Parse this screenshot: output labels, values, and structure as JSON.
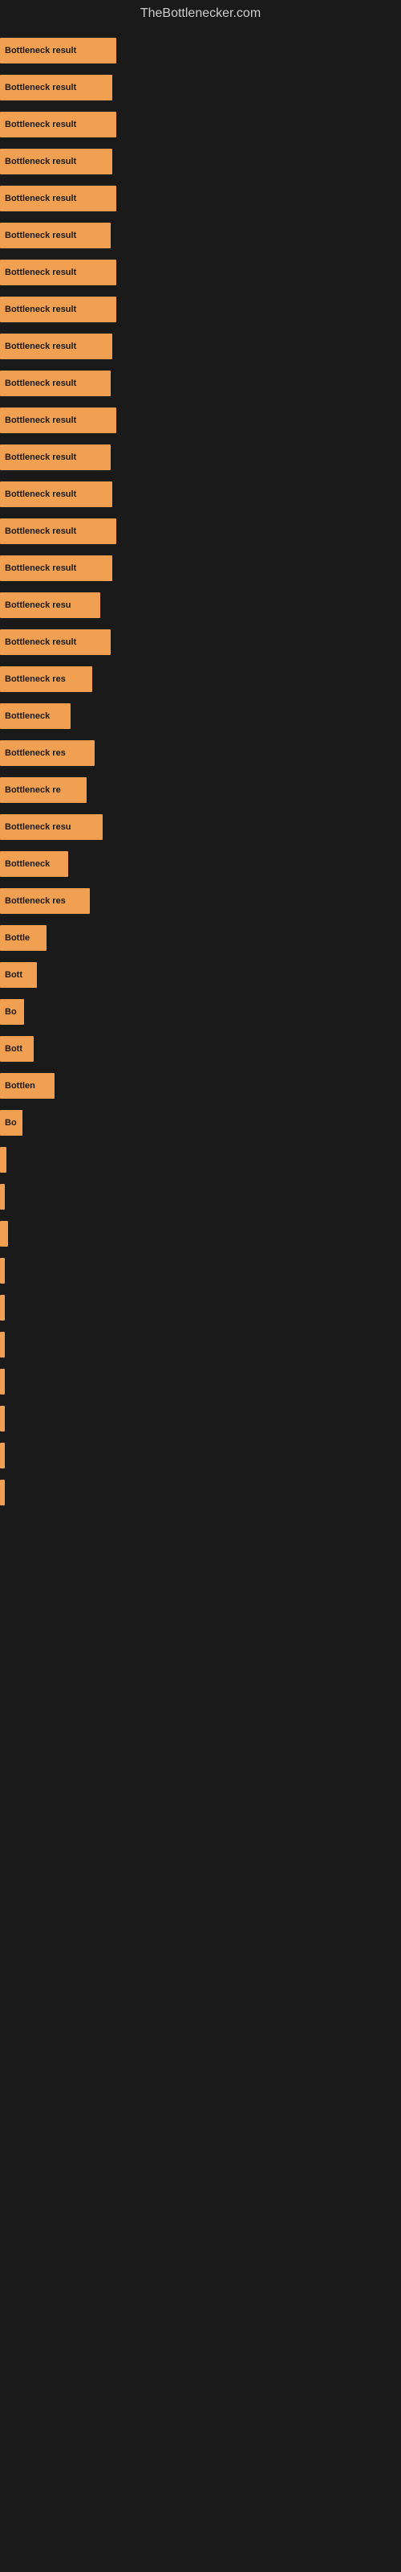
{
  "header": {
    "title": "TheBottlenecker.com"
  },
  "bars": [
    {
      "label": "Bottleneck result",
      "width": 145
    },
    {
      "label": "Bottleneck result",
      "width": 140
    },
    {
      "label": "Bottleneck result",
      "width": 145
    },
    {
      "label": "Bottleneck result",
      "width": 140
    },
    {
      "label": "Bottleneck result",
      "width": 145
    },
    {
      "label": "Bottleneck result",
      "width": 138
    },
    {
      "label": "Bottleneck result",
      "width": 145
    },
    {
      "label": "Bottleneck result",
      "width": 145
    },
    {
      "label": "Bottleneck result",
      "width": 140
    },
    {
      "label": "Bottleneck result",
      "width": 138
    },
    {
      "label": "Bottleneck result",
      "width": 145
    },
    {
      "label": "Bottleneck result",
      "width": 138
    },
    {
      "label": "Bottleneck result",
      "width": 140
    },
    {
      "label": "Bottleneck result",
      "width": 145
    },
    {
      "label": "Bottleneck result",
      "width": 140
    },
    {
      "label": "Bottleneck resu",
      "width": 125
    },
    {
      "label": "Bottleneck result",
      "width": 138
    },
    {
      "label": "Bottleneck res",
      "width": 115
    },
    {
      "label": "Bottleneck",
      "width": 88
    },
    {
      "label": "Bottleneck res",
      "width": 118
    },
    {
      "label": "Bottleneck re",
      "width": 108
    },
    {
      "label": "Bottleneck resu",
      "width": 128
    },
    {
      "label": "Bottleneck",
      "width": 85
    },
    {
      "label": "Bottleneck res",
      "width": 112
    },
    {
      "label": "Bottle",
      "width": 58
    },
    {
      "label": "Bott",
      "width": 46
    },
    {
      "label": "Bo",
      "width": 30
    },
    {
      "label": "Bott",
      "width": 42
    },
    {
      "label": "Bottlen",
      "width": 68
    },
    {
      "label": "Bo",
      "width": 28
    },
    {
      "label": "",
      "width": 8
    },
    {
      "label": "",
      "width": 5
    },
    {
      "label": "",
      "width": 10
    },
    {
      "label": "",
      "width": 4
    },
    {
      "label": "",
      "width": 4
    },
    {
      "label": "",
      "width": 4
    },
    {
      "label": "",
      "width": 4
    },
    {
      "label": "",
      "width": 4
    },
    {
      "label": "",
      "width": 4
    },
    {
      "label": "",
      "width": 4
    }
  ]
}
